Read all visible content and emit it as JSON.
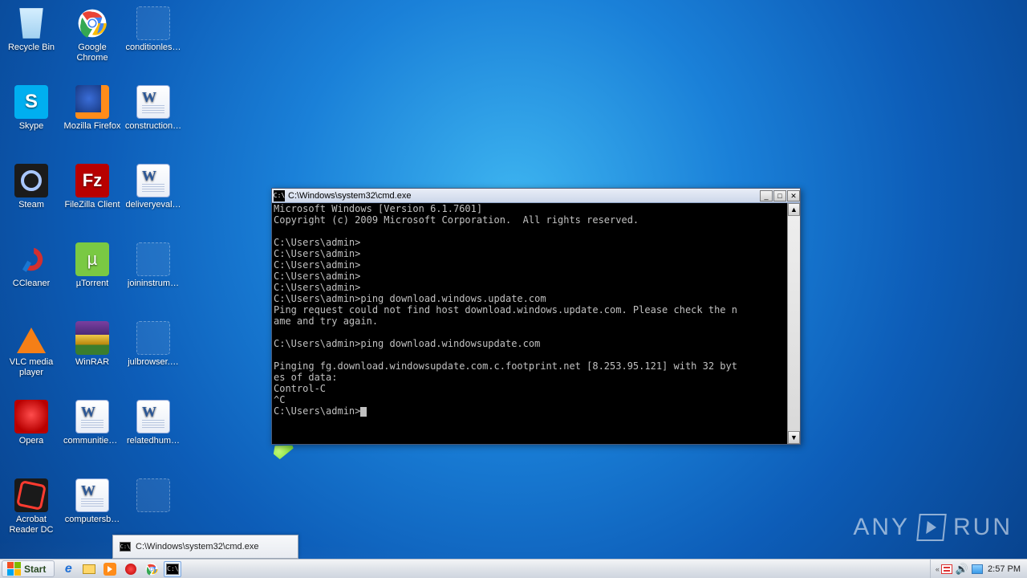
{
  "desktop_icons": [
    {
      "id": "recycle-bin",
      "label": "Recycle Bin",
      "col": 0,
      "row": 0,
      "glyph": "bin"
    },
    {
      "id": "google-chrome",
      "label": "Google Chrome",
      "col": 1,
      "row": 0,
      "glyph": "chrome",
      "two": true
    },
    {
      "id": "conditionles",
      "label": "conditionles…",
      "col": 2,
      "row": 0,
      "glyph": "shortcut"
    },
    {
      "id": "skype",
      "label": "Skype",
      "col": 0,
      "row": 1,
      "glyph": "skype"
    },
    {
      "id": "firefox",
      "label": "Mozilla Firefox",
      "col": 1,
      "row": 1,
      "glyph": "ff"
    },
    {
      "id": "construction",
      "label": "construction…",
      "col": 2,
      "row": 1,
      "glyph": "doc"
    },
    {
      "id": "steam",
      "label": "Steam",
      "col": 0,
      "row": 2,
      "glyph": "steam"
    },
    {
      "id": "filezilla",
      "label": "FileZilla Client",
      "col": 1,
      "row": 2,
      "glyph": "fz"
    },
    {
      "id": "deliveryeval",
      "label": "deliveryeval…",
      "col": 2,
      "row": 2,
      "glyph": "doc"
    },
    {
      "id": "ccleaner",
      "label": "CCleaner",
      "col": 0,
      "row": 3,
      "glyph": "cc"
    },
    {
      "id": "utorrent",
      "label": "µTorrent",
      "col": 1,
      "row": 3,
      "glyph": "ut"
    },
    {
      "id": "joininstrum",
      "label": "joininstrum…",
      "col": 2,
      "row": 3,
      "glyph": "shortcut"
    },
    {
      "id": "vlc",
      "label": "VLC media player",
      "col": 0,
      "row": 4,
      "glyph": "vlc",
      "two": true
    },
    {
      "id": "winrar",
      "label": "WinRAR",
      "col": 1,
      "row": 4,
      "glyph": "rar"
    },
    {
      "id": "julbrowser",
      "label": "julbrowser.…",
      "col": 2,
      "row": 4,
      "glyph": "shortcut"
    },
    {
      "id": "opera",
      "label": "Opera",
      "col": 0,
      "row": 5,
      "glyph": "opera"
    },
    {
      "id": "communities",
      "label": "communities…",
      "col": 1,
      "row": 5,
      "glyph": "doc"
    },
    {
      "id": "relatedhum",
      "label": "relatedhum…",
      "col": 2,
      "row": 5,
      "glyph": "doc"
    },
    {
      "id": "acrobat",
      "label": "Acrobat Reader DC",
      "col": 0,
      "row": 6,
      "glyph": "acro",
      "two": true
    },
    {
      "id": "computersb",
      "label": "computersb…",
      "col": 1,
      "row": 6,
      "glyph": "doc"
    },
    {
      "id": "blank-sc",
      "label": "",
      "col": 2,
      "row": 6,
      "glyph": "shortcut"
    }
  ],
  "cmd": {
    "title": "C:\\Windows\\system32\\cmd.exe",
    "lines": [
      "Microsoft Windows [Version 6.1.7601]",
      "Copyright (c) 2009 Microsoft Corporation.  All rights reserved.",
      "",
      "C:\\Users\\admin>",
      "C:\\Users\\admin>",
      "C:\\Users\\admin>",
      "C:\\Users\\admin>",
      "C:\\Users\\admin>",
      "C:\\Users\\admin>ping download.windows.update.com",
      "Ping request could not find host download.windows.update.com. Please check the n",
      "ame and try again.",
      "",
      "C:\\Users\\admin>ping download.windowsupdate.com",
      "",
      "Pinging fg.download.windowsupdate.com.c.footprint.net [8.253.95.121] with 32 byt",
      "es of data:",
      "Control-C",
      "^C",
      "C:\\Users\\admin>"
    ]
  },
  "taskbar": {
    "start_label": "Start",
    "preview_title": "C:\\Windows\\system32\\cmd.exe",
    "clock": "2:57 PM"
  },
  "watermark": {
    "brand_a": "ANY",
    "brand_b": "RUN"
  }
}
